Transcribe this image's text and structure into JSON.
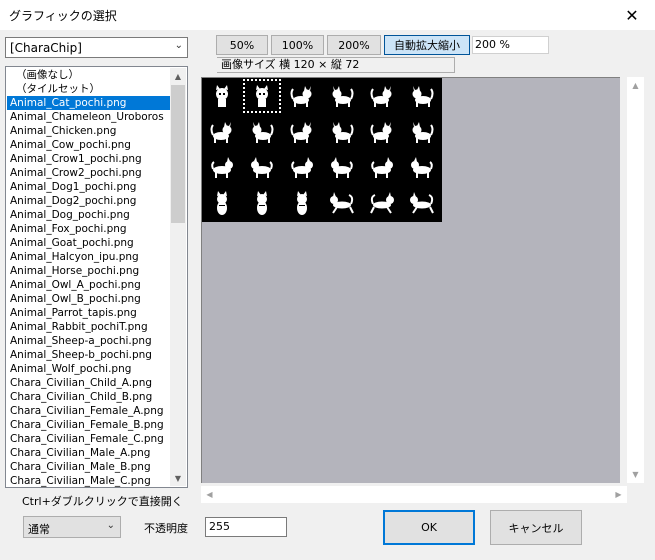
{
  "window": {
    "title": "グラフィックの選択",
    "close_glyph": "✕"
  },
  "folder": {
    "selected": "[CharaChip]"
  },
  "file_list": {
    "items": [
      "（画像なし）",
      "（タイルセット）",
      "Animal_Cat_pochi.png",
      "Animal_Chameleon_Uroboros",
      "Animal_Chicken.png",
      "Animal_Cow_pochi.png",
      "Animal_Crow1_pochi.png",
      "Animal_Crow2_pochi.png",
      "Animal_Dog1_pochi.png",
      "Animal_Dog2_pochi.png",
      "Animal_Dog_pochi.png",
      "Animal_Fox_pochi.png",
      "Animal_Goat_pochi.png",
      "Animal_Halcyon_ipu.png",
      "Animal_Horse_pochi.png",
      "Animal_Owl_A_pochi.png",
      "Animal_Owl_B_pochi.png",
      "Animal_Parrot_tapis.png",
      "Animal_Rabbit_pochiT.png",
      "Animal_Sheep-a_pochi.png",
      "Animal_Sheep-b_pochi.png",
      "Animal_Wolf_pochi.png",
      "Chara_Civilian_Child_A.png",
      "Chara_Civilian_Child_B.png",
      "Chara_Civilian_Female_A.png",
      "Chara_Civilian_Female_B.png",
      "Chara_Civilian_Female_C.png",
      "Chara_Civilian_Male_A.png",
      "Chara_Civilian_Male_B.png",
      "Chara_Civilian_Male_C.png"
    ],
    "selected_index": 2
  },
  "hint": "Ctrl+ダブルクリックで直接開く",
  "zoom": {
    "btn_50": "50%",
    "btn_100": "100%",
    "btn_200": "200%",
    "btn_auto": "自動拡大縮小",
    "value": "200 %"
  },
  "image_info": "画像サイズ  横 120 × 縦 72",
  "sprite_sheet": {
    "cols": 6,
    "rows": 4,
    "selected_cell": 1,
    "poses": [
      "front",
      "front",
      "side",
      "side",
      "side",
      "side",
      "side",
      "side",
      "side",
      "side",
      "side",
      "side",
      "walk",
      "walk",
      "walk",
      "walk",
      "walk",
      "walk",
      "sit",
      "sit",
      "sit",
      "run",
      "run",
      "run"
    ]
  },
  "blend": {
    "selected": "通常"
  },
  "opacity": {
    "label": "不透明度",
    "value": "255"
  },
  "buttons": {
    "ok": "OK",
    "cancel": "キャンセル"
  },
  "colors": {
    "selection": "#0078d7",
    "viewer_bg": "#b4b4bc"
  }
}
